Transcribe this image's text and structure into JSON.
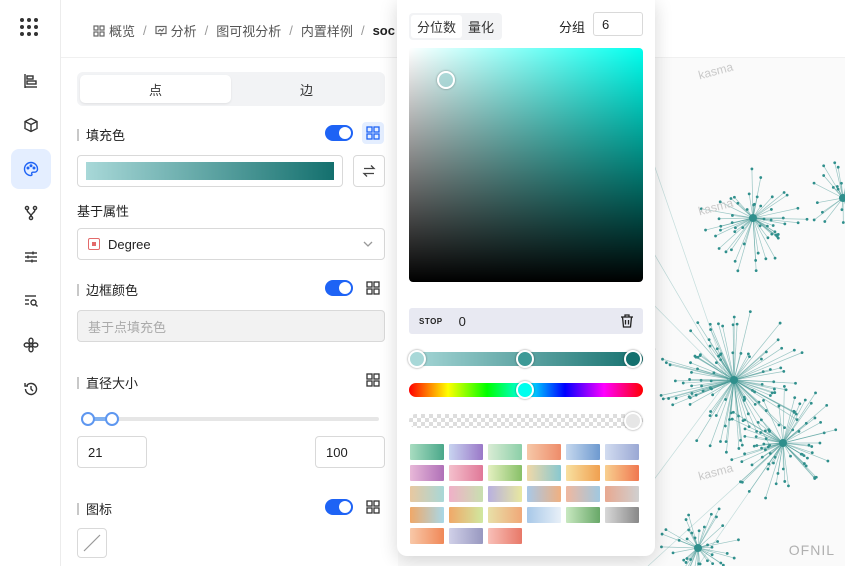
{
  "breadcrumb": [
    "概览",
    "分析",
    "图可视分析",
    "内置样例",
    "soc"
  ],
  "style_panel": {
    "tabs": [
      "点",
      "边"
    ],
    "active_tab": "点",
    "fill_color_label": "填充色",
    "fill_gradient": [
      "#a8d8d8",
      "#14706e"
    ],
    "based_on_label": "基于属性",
    "property_value": "Degree",
    "border_color_label": "边框颜色",
    "border_placeholder": "基于点填充色",
    "size_label": "直径大小",
    "size_min": "21",
    "size_max": "100",
    "icon_label": "图标"
  },
  "color_picker": {
    "modes": [
      "分位数",
      "量化"
    ],
    "active_mode": "分位数",
    "group_label": "分组",
    "group_value": "6",
    "stop_tag": "STOP",
    "stop_value": "0",
    "hue": "#00ffee",
    "stops": [
      "#a8d8d8",
      "#3d9a97",
      "#14706e"
    ],
    "presets": [
      [
        "#a8dcc0",
        "#4aa88a"
      ],
      [
        "#c8d4f0",
        "#9a78c8"
      ],
      [
        "#d9ecd4",
        "#8ccfa8"
      ],
      [
        "#f6c8a8",
        "#ee8c6a"
      ],
      [
        "#c6d8ee",
        "#6e9ad0"
      ],
      [
        "#d2dcf0",
        "#9aa8d4"
      ],
      [
        "#e8b8d8",
        "#b070b8"
      ],
      [
        "#f4c0cc",
        "#e07898"
      ],
      [
        "#e4f0c0",
        "#88c068"
      ],
      [
        "#f0d8a8",
        "#88c8d0"
      ],
      [
        "#f8e0a0",
        "#f0a050"
      ],
      [
        "#f8d090",
        "#f07850"
      ],
      [
        "#e8c8a0",
        "#a8d8d8"
      ],
      [
        "#f0b0c8",
        "#c8e0b0"
      ],
      [
        "#b8b0e0",
        "#e8e8a0"
      ],
      [
        "#a8c8e8",
        "#f0b080"
      ],
      [
        "#f0b8a0",
        "#a0c8e0"
      ],
      [
        "#e8a890",
        "#d0d0d0"
      ],
      [
        "#f0a868",
        "#a8d8e8"
      ],
      [
        "#f0a868",
        "#d0e8a0"
      ],
      [
        "#e8e0a8",
        "#f0a878"
      ],
      [
        "#a8c8e8",
        "#e8f0f8"
      ],
      [
        "#c8e8c0",
        "#68a868"
      ],
      [
        "#d8d8d8",
        "#888888"
      ],
      [
        "#f8c8a8",
        "#f08858"
      ],
      [
        "#d0d0e8",
        "#9898c0"
      ],
      [
        "#f8c0b8",
        "#e87868"
      ]
    ]
  },
  "watermarks": [
    "kasma",
    "kasma",
    "kasma",
    "kasma"
  ],
  "brand_mark": "OFNIL"
}
